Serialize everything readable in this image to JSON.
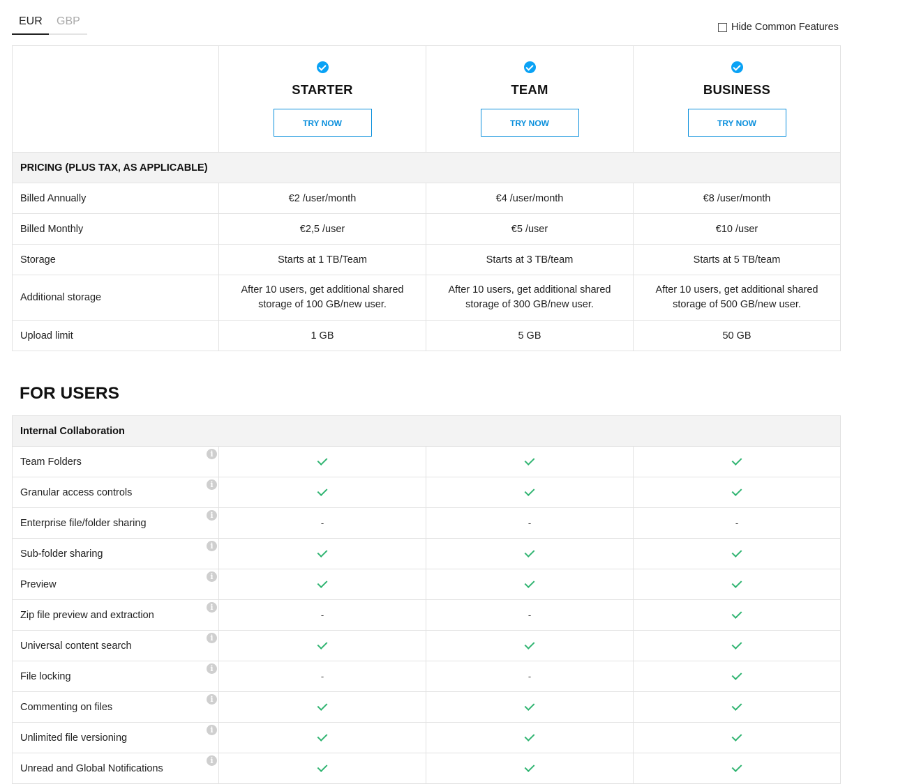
{
  "currency": {
    "tabs": [
      "EUR",
      "GBP"
    ],
    "selected": "EUR"
  },
  "hide_common_label": "Hide Common Features",
  "plans": [
    {
      "name": "STARTER",
      "cta": "TRY NOW"
    },
    {
      "name": "TEAM",
      "cta": "TRY NOW"
    },
    {
      "name": "BUSINESS",
      "cta": "TRY NOW"
    }
  ],
  "pricing": {
    "section_title": "PRICING (PLUS TAX, AS APPLICABLE)",
    "rows": [
      {
        "label": "Billed Annually",
        "values": [
          "€2 /user/month",
          "€4 /user/month",
          "€8 /user/month"
        ]
      },
      {
        "label": "Billed Monthly",
        "values": [
          "€2,5 /user",
          "€5 /user",
          "€10 /user"
        ]
      },
      {
        "label": "Storage",
        "values": [
          "Starts at 1 TB/Team",
          "Starts at 3 TB/team",
          "Starts at 5 TB/team"
        ]
      },
      {
        "label": "Additional storage",
        "values": [
          "After 10 users, get additional shared storage of 100 GB/new user.",
          "After 10 users, get additional shared storage of 300 GB/new user.",
          "After 10 users, get additional shared storage of 500 GB/new user."
        ]
      },
      {
        "label": "Upload limit",
        "values": [
          "1 GB",
          "5 GB",
          "50 GB"
        ]
      }
    ]
  },
  "for_users_heading": "FOR USERS",
  "internal_collab": {
    "section_title": "Internal Collaboration",
    "dash_text": "-",
    "info_glyph": "i",
    "features": [
      {
        "label": "Team Folders",
        "values": [
          "check",
          "check",
          "check"
        ]
      },
      {
        "label": "Granular access controls",
        "values": [
          "check",
          "check",
          "check"
        ]
      },
      {
        "label": "Enterprise file/folder sharing",
        "values": [
          "dash",
          "dash",
          "dash"
        ]
      },
      {
        "label": "Sub-folder sharing",
        "values": [
          "check",
          "check",
          "check"
        ]
      },
      {
        "label": "Preview",
        "values": [
          "check",
          "check",
          "check"
        ]
      },
      {
        "label": "Zip file preview and extraction",
        "values": [
          "dash",
          "dash",
          "check"
        ]
      },
      {
        "label": "Universal content search",
        "values": [
          "check",
          "check",
          "check"
        ]
      },
      {
        "label": "File locking",
        "values": [
          "dash",
          "dash",
          "check"
        ]
      },
      {
        "label": "Commenting on files",
        "values": [
          "check",
          "check",
          "check"
        ]
      },
      {
        "label": "Unlimited file versioning",
        "values": [
          "check",
          "check",
          "check"
        ]
      },
      {
        "label": "Unread and Global Notifications",
        "values": [
          "check",
          "check",
          "check"
        ]
      }
    ]
  },
  "colors": {
    "accent": "#0a8fdc",
    "check_badge": "#0aa2f5",
    "tick": "#2fb471",
    "section_bg": "#f3f3f3",
    "border": "#e2e2e2"
  }
}
